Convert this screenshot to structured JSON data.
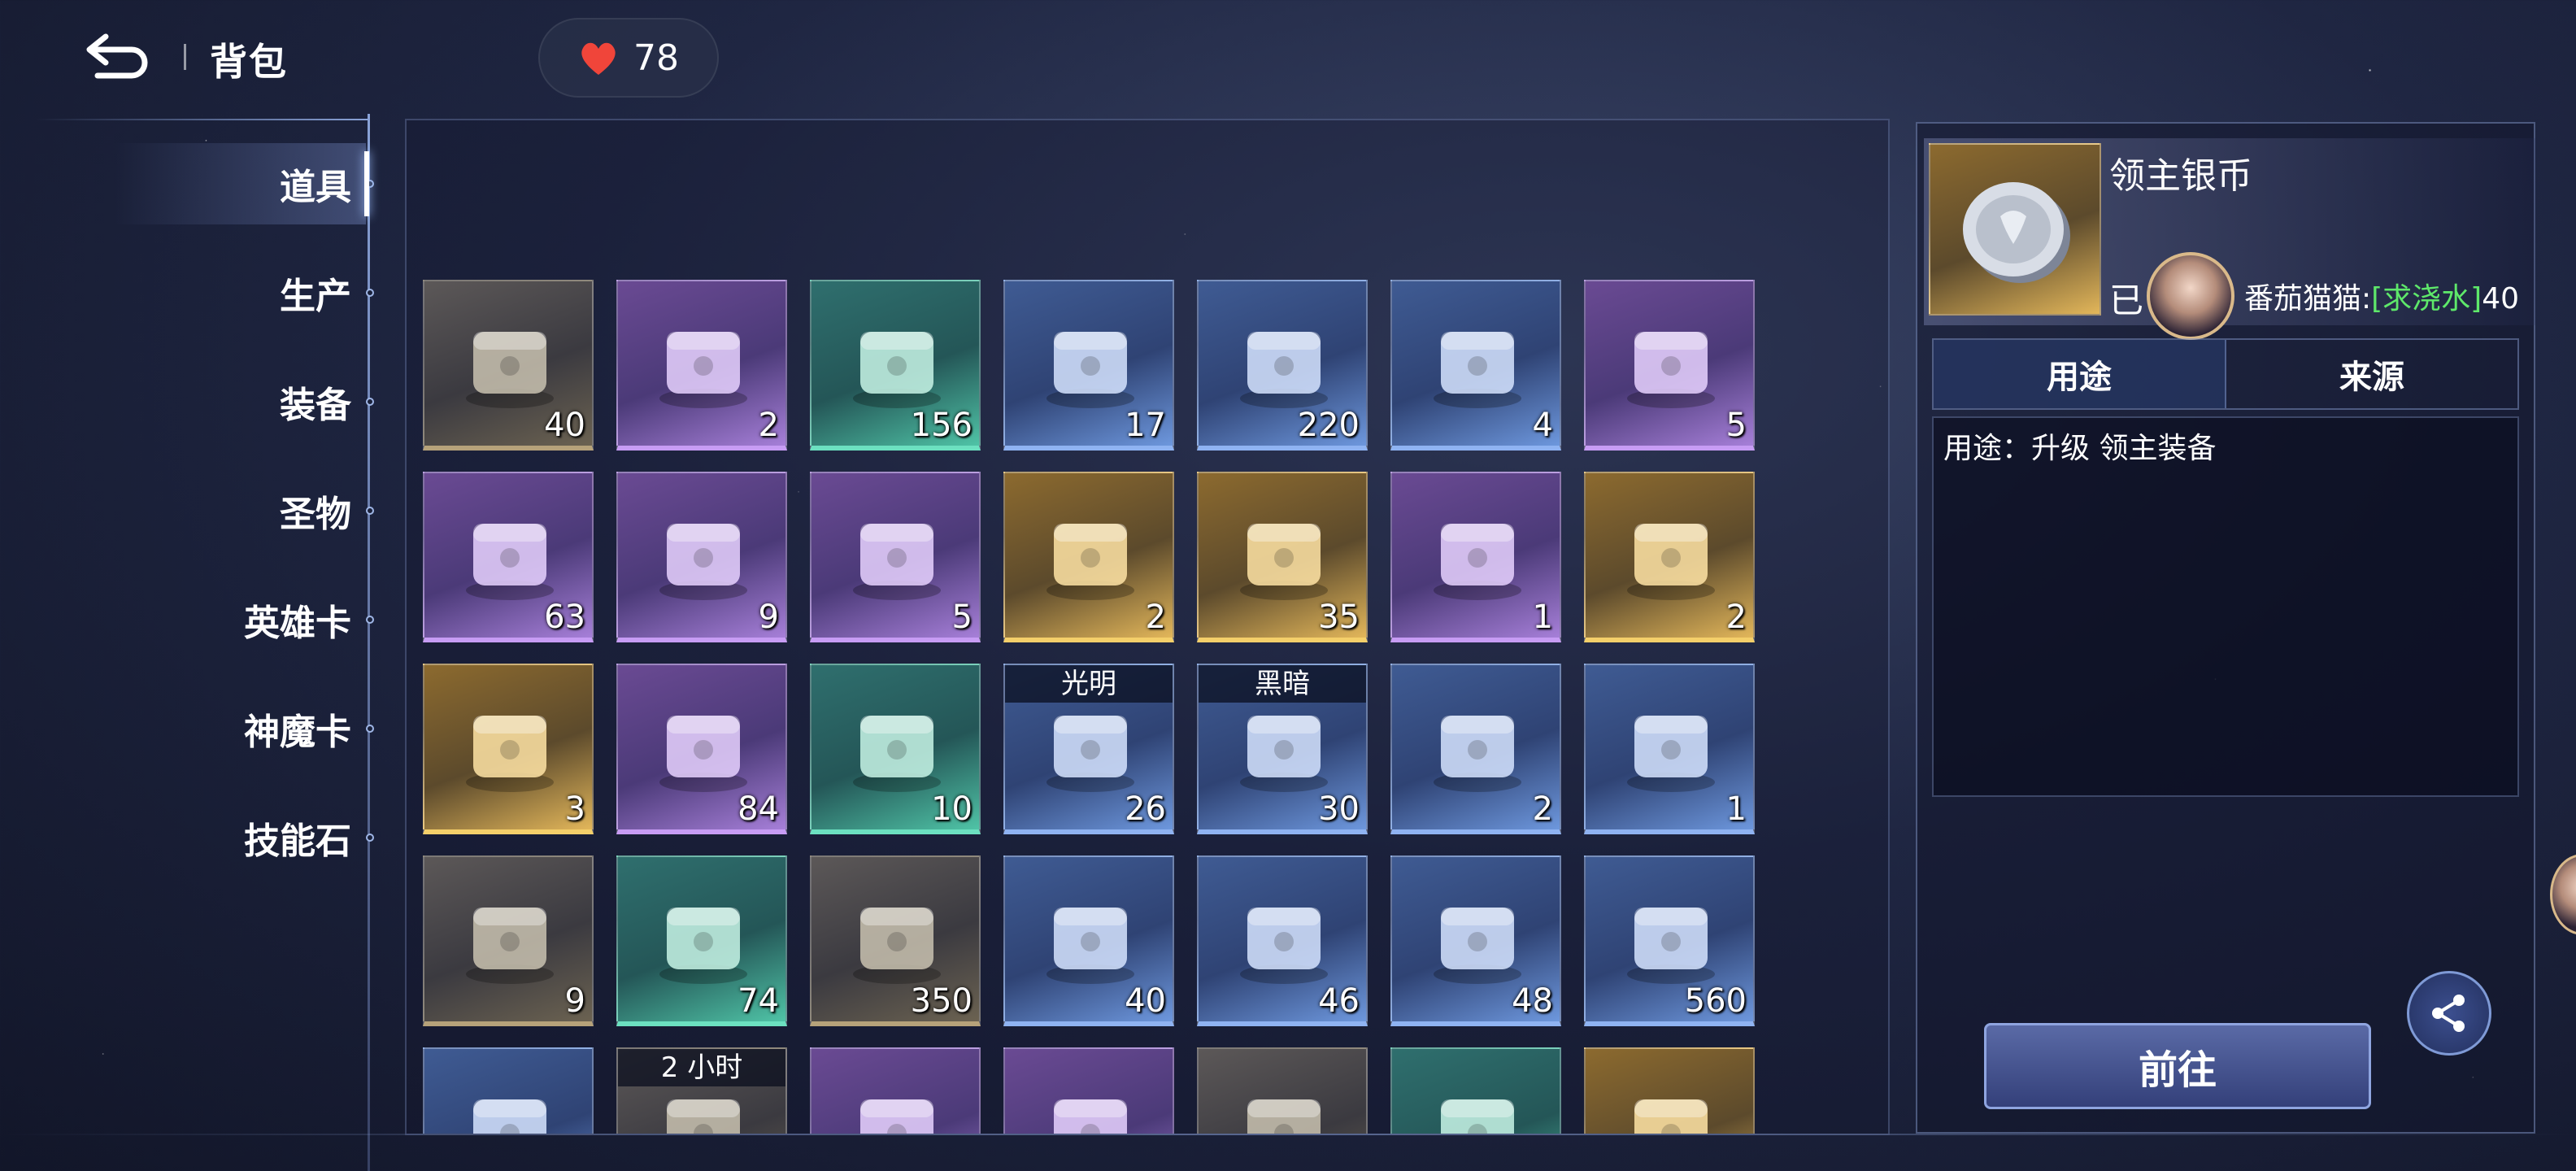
{
  "header": {
    "title": "背包",
    "stamina": "78"
  },
  "tabs": [
    "道具",
    "生产",
    "装备",
    "圣物",
    "英雄卡",
    "神魔卡",
    "技能石"
  ],
  "items": [
    {
      "icon": "check-stone-icon",
      "rarity": "gray",
      "count": "40"
    },
    {
      "icon": "gift-box-icon",
      "rarity": "purple",
      "count": "2"
    },
    {
      "icon": "supply-crate-icon",
      "rarity": "teal",
      "count": "156"
    },
    {
      "icon": "supply-crate-icon",
      "rarity": "blue",
      "count": "17"
    },
    {
      "icon": "wooden-chest-icon",
      "rarity": "blue",
      "count": "220"
    },
    {
      "icon": "milk-bottle-icon",
      "rarity": "blue",
      "count": "4"
    },
    {
      "icon": "milk-bottle-icon",
      "rarity": "purple",
      "count": "5"
    },
    {
      "icon": "scroll-icon",
      "rarity": "purple",
      "count": "63"
    },
    {
      "icon": "winged-emblem-icon",
      "rarity": "purple",
      "count": "9"
    },
    {
      "icon": "gold-crystal-icon",
      "rarity": "purple",
      "count": "5"
    },
    {
      "icon": "envelope-icon",
      "rarity": "gold",
      "count": "2"
    },
    {
      "icon": "envelope-icon",
      "rarity": "gold",
      "count": "35"
    },
    {
      "icon": "treasure-chest-icon",
      "rarity": "purple",
      "count": "1"
    },
    {
      "icon": "treasure-chest-icon",
      "rarity": "gold",
      "count": "2"
    },
    {
      "icon": "ruby-orb-icon",
      "rarity": "gold",
      "count": "3"
    },
    {
      "icon": "potion-icon",
      "rarity": "purple",
      "count": "84"
    },
    {
      "icon": "crystal-card-icon",
      "rarity": "teal",
      "count": "10"
    },
    {
      "icon": "light-puzzle-icon",
      "rarity": "blue",
      "count": "26",
      "tag": "光明"
    },
    {
      "icon": "dark-puzzle-icon",
      "rarity": "blue",
      "count": "30",
      "tag": "黑暗"
    },
    {
      "icon": "open-chest-icon",
      "rarity": "blue",
      "count": "2"
    },
    {
      "icon": "open-chest-icon",
      "rarity": "blue",
      "count": "1"
    },
    {
      "icon": "chest-stack-icon",
      "rarity": "gray",
      "count": "9"
    },
    {
      "icon": "chest-stack-icon",
      "rarity": "teal",
      "count": "74"
    },
    {
      "icon": "chest-stack-icon",
      "rarity": "gray",
      "count": "350"
    },
    {
      "icon": "chest-stack-icon",
      "rarity": "blue",
      "count": "40"
    },
    {
      "icon": "hammer-icon",
      "rarity": "blue",
      "count": "46"
    },
    {
      "icon": "paper-stack-icon",
      "rarity": "blue",
      "count": "48"
    },
    {
      "icon": "medkit-icon",
      "rarity": "blue",
      "count": "560"
    },
    {
      "icon": "portal-icon",
      "rarity": "blue",
      "count": ""
    },
    {
      "icon": "sprout-icon",
      "rarity": "gray",
      "count": "",
      "tag": "2 小时"
    },
    {
      "icon": "blue-gem-icon",
      "rarity": "purple",
      "count": ""
    },
    {
      "icon": "purple-gem-icon",
      "rarity": "purple",
      "count": ""
    },
    {
      "icon": "blue-gem-icon",
      "rarity": "gray",
      "count": ""
    },
    {
      "icon": "blue-gem-icon",
      "rarity": "teal",
      "count": ""
    },
    {
      "icon": "gold-ticket-icon",
      "rarity": "gold",
      "count": ""
    }
  ],
  "detail": {
    "name": "领主银币",
    "owned_label": "已",
    "chat_name": "番茄猫猫:",
    "chat_message": "[求浇水]",
    "chat_trailing": "40",
    "tabs": [
      "用途",
      "来源"
    ],
    "usage": "用途：升级 领主装备",
    "go_button": "前往"
  },
  "colors": {
    "gray": "#5c5858",
    "purple": "#6a4a93",
    "teal": "#2f6f6e",
    "blue": "#3f5b93",
    "gold": "#8c6a2f",
    "chat_message": "#5ee86a"
  }
}
